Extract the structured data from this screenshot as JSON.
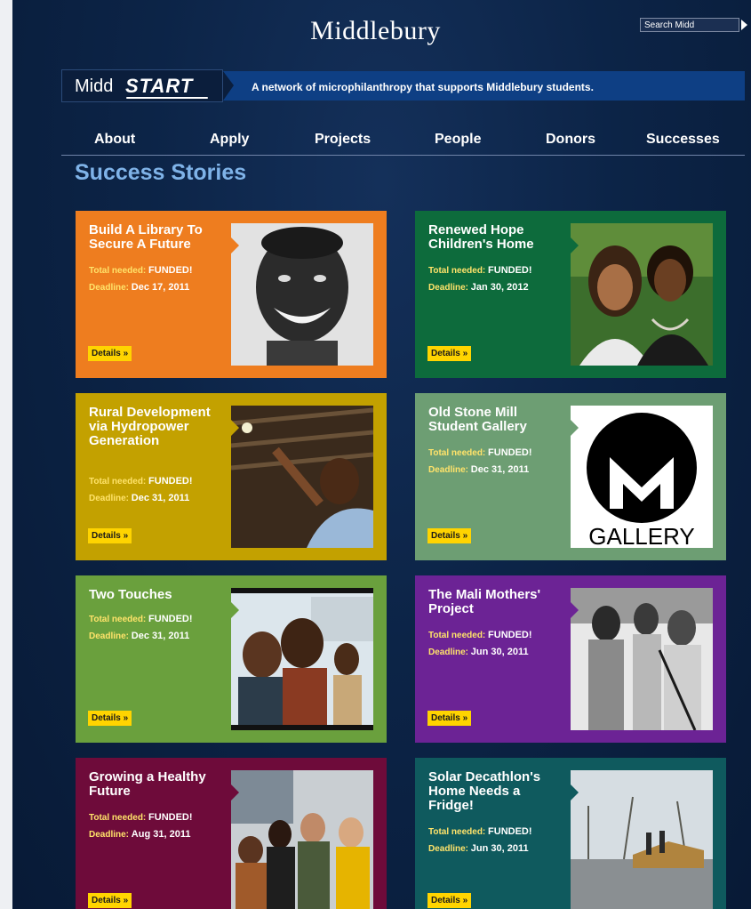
{
  "header": {
    "brand": "Middlebury",
    "search_placeholder": "Search Midd"
  },
  "banner": {
    "logo_midd": "Midd",
    "logo_start": "START",
    "tagline": "A network of microphilanthropy that supports Middlebury students."
  },
  "nav": {
    "items": [
      "About",
      "Apply",
      "Projects",
      "People",
      "Donors",
      "Successes"
    ]
  },
  "page_title": "Success Stories",
  "labels": {
    "total_needed": "Total needed:",
    "deadline": "Deadline:",
    "details": "Details »"
  },
  "cards": [
    {
      "title": "Build A Library To Secure A Future",
      "total": "FUNDED!",
      "deadline": "Dec 17, 2011",
      "color": "#ee7d1f",
      "photo": "smiling-man"
    },
    {
      "title": "Renewed Hope Children's Home",
      "total": "FUNDED!",
      "deadline": "Jan 30, 2012",
      "color": "#0d6b3c",
      "photo": "two-women"
    },
    {
      "title": "Rural Development via Hydropower Generation",
      "total": "FUNDED!",
      "deadline": "Dec 31, 2011",
      "color": "#c3a100",
      "photo": "boy-in-shed"
    },
    {
      "title": "Old Stone Mill Student Gallery",
      "total": "FUNDED!",
      "deadline": "Dec 31, 2011",
      "color": "#6d9e73",
      "photo": "m-gallery-logo",
      "logo_text": "GALLERY"
    },
    {
      "title": "Two Touches",
      "total": "FUNDED!",
      "deadline": "Dec 31, 2011",
      "color": "#6aa03d",
      "photo": "children-group"
    },
    {
      "title": "The Mali Mothers' Project",
      "total": "FUNDED!",
      "deadline": "Jun 30, 2011",
      "color": "#6c2395",
      "photo": "women-snow"
    },
    {
      "title": "Growing a Healthy Future",
      "total": "FUNDED!",
      "deadline": "Aug 31, 2011",
      "color": "#6e0b3a",
      "photo": "students-group"
    },
    {
      "title": "Solar Decathlon's Home Needs a Fridge!",
      "total": "FUNDED!",
      "deadline": "Jun 30, 2011",
      "color": "#0f5a5e",
      "photo": "house-frame"
    }
  ]
}
